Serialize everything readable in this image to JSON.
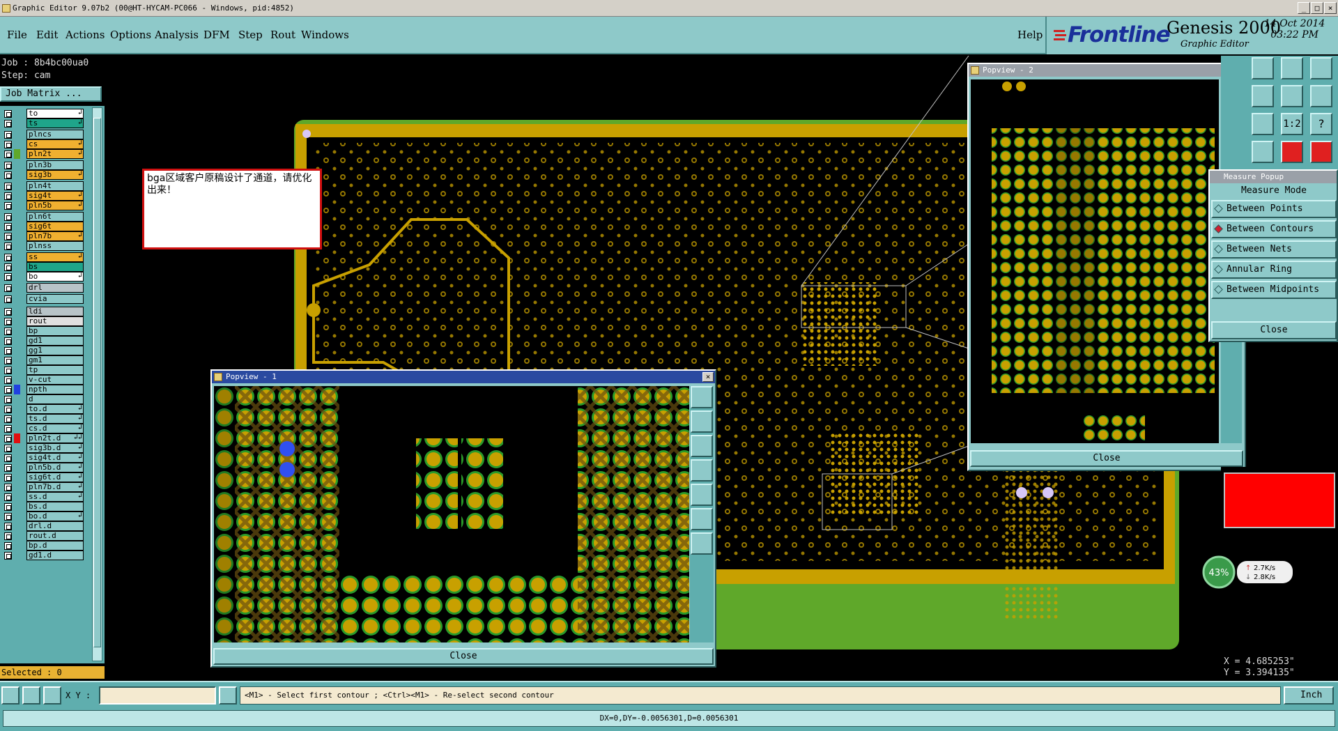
{
  "window": {
    "title": "Graphic Editor 9.07b2 (00@HT-HYCAM-PC066 - Windows, pid:4852)"
  },
  "menu": {
    "items": [
      "File",
      "Edit",
      "Actions",
      "Options",
      "Analysis",
      "DFM",
      "Step",
      "Rout",
      "Windows"
    ],
    "help": "Help"
  },
  "brand": {
    "logo": "Frontline",
    "product": "Genesis 2000",
    "subtitle": "Graphic Editor",
    "date": "14 Oct 2014",
    "time": "03:22 PM"
  },
  "job": {
    "job_label": "Job  : 8b4bc00ua0",
    "step_label": "Step: cam",
    "matrix_button": "Job Matrix ..."
  },
  "layers": [
    {
      "name": "to",
      "color": "#ffffff",
      "arrow": "↲"
    },
    {
      "name": "ts",
      "color": "#1fa58a",
      "arrow": "↲"
    },
    {
      "name": "plncs",
      "color": "#8ec9c9",
      "arrow": ""
    },
    {
      "name": "cs",
      "color": "#f0b030",
      "arrow": "↲"
    },
    {
      "name": "pln2t",
      "color": "#f0b030",
      "arrow": "↲",
      "swatch": "#5fa82a"
    },
    {
      "name": "pln3b",
      "color": "#8ec9c9",
      "arrow": ""
    },
    {
      "name": "sig3b",
      "color": "#f0b030",
      "arrow": "↲"
    },
    {
      "name": "pln4t",
      "color": "#8ec9c9",
      "arrow": ""
    },
    {
      "name": "sig4t",
      "color": "#f0b030",
      "arrow": "↲"
    },
    {
      "name": "pln5b",
      "color": "#f0b030",
      "arrow": "↲"
    },
    {
      "name": "pln6t",
      "color": "#8ec9c9",
      "arrow": ""
    },
    {
      "name": "sig6t",
      "color": "#f0b030",
      "arrow": ""
    },
    {
      "name": "pln7b",
      "color": "#f0b030",
      "arrow": "↲"
    },
    {
      "name": "plnss",
      "color": "#8ec9c9",
      "arrow": ""
    },
    {
      "name": "ss",
      "color": "#f0b030",
      "arrow": "↲"
    },
    {
      "name": "bs",
      "color": "#1fa58a",
      "arrow": ""
    },
    {
      "name": "bo",
      "color": "#ffffff",
      "arrow": "↲"
    },
    {
      "name": "drl",
      "color": "#b8c4c8",
      "arrow": ""
    },
    {
      "name": "cvia",
      "color": "#8ec9c9",
      "arrow": ""
    },
    {
      "name": "ldi",
      "color": "#b8c4c8",
      "arrow": ""
    },
    {
      "name": "rout",
      "color": "#e0e0e0",
      "arrow": ""
    },
    {
      "name": "bp",
      "color": "#8ec9c9",
      "arrow": ""
    },
    {
      "name": "gd1",
      "color": "#8ec9c9",
      "arrow": ""
    },
    {
      "name": "gg1",
      "color": "#8ec9c9",
      "arrow": ""
    },
    {
      "name": "gm1",
      "color": "#8ec9c9",
      "arrow": ""
    },
    {
      "name": "tp",
      "color": "#8ec9c9",
      "arrow": ""
    },
    {
      "name": "v-cut",
      "color": "#8ec9c9",
      "arrow": ""
    },
    {
      "name": "npth",
      "color": "#8ec9c9",
      "arrow": "",
      "swatch": "#2040e0"
    },
    {
      "name": "d",
      "color": "#8ec9c9",
      "arrow": ""
    },
    {
      "name": "to.d",
      "color": "#8ec9c9",
      "arrow": "↲"
    },
    {
      "name": "ts.d",
      "color": "#8ec9c9",
      "arrow": "↲"
    },
    {
      "name": "cs.d",
      "color": "#8ec9c9",
      "arrow": "↲"
    },
    {
      "name": "pln2t.d",
      "color": "#8ec9c9",
      "arrow": "↲↲",
      "swatch": "#e01010"
    },
    {
      "name": "sig3b.d",
      "color": "#8ec9c9",
      "arrow": "↲"
    },
    {
      "name": "sig4t.d",
      "color": "#8ec9c9",
      "arrow": "↲"
    },
    {
      "name": "pln5b.d",
      "color": "#8ec9c9",
      "arrow": "↲"
    },
    {
      "name": "sig6t.d",
      "color": "#8ec9c9",
      "arrow": "↲"
    },
    {
      "name": "pln7b.d",
      "color": "#8ec9c9",
      "arrow": "↲"
    },
    {
      "name": "ss.d",
      "color": "#8ec9c9",
      "arrow": "↲"
    },
    {
      "name": "bs.d",
      "color": "#8ec9c9",
      "arrow": ""
    },
    {
      "name": "bo.d",
      "color": "#8ec9c9",
      "arrow": "↲"
    },
    {
      "name": "drl.d",
      "color": "#8ec9c9",
      "arrow": ""
    },
    {
      "name": "rout.d",
      "color": "#8ec9c9",
      "arrow": ""
    },
    {
      "name": "bp.d",
      "color": "#8ec9c9",
      "arrow": ""
    },
    {
      "name": "gd1.d",
      "color": "#8ec9c9",
      "arrow": ""
    }
  ],
  "selected": "Selected : 0",
  "note": "bga区域客户原稿设计了通道，请优化出来！",
  "popview1": {
    "title": "Popview - 1",
    "close": "Close"
  },
  "popview2": {
    "title": "Popview - 2",
    "close": "Close"
  },
  "measure": {
    "title": "Measure Popup",
    "mode": "Measure Mode",
    "options": [
      "Between Points",
      "Between Contours",
      "Between Nets",
      "Annular Ring",
      "Between Midpoints"
    ],
    "selected": "Between Contours",
    "close": "Close"
  },
  "coords": {
    "x": "X = 4.685253\"",
    "y": "Y = 3.394135\""
  },
  "toolbar_right": {
    "ratio": "1:2",
    "help": "?"
  },
  "network": {
    "percent": "43%",
    "up": "2.7K/s",
    "down": "2.8K/s"
  },
  "bottom": {
    "xy_label": "X Y :",
    "message": "<M1> - Select first contour ; <Ctrl><M1> - Re-select second contour",
    "unit": "Inch"
  },
  "status": {
    "text": "DX=0,DY=-0.0056301,D=0.0056301"
  },
  "colors": {
    "panel": "#8ec9c9",
    "pcb_copper": "#c8a000",
    "pcb_green": "#5fa82a",
    "selected": "#e8b232"
  }
}
